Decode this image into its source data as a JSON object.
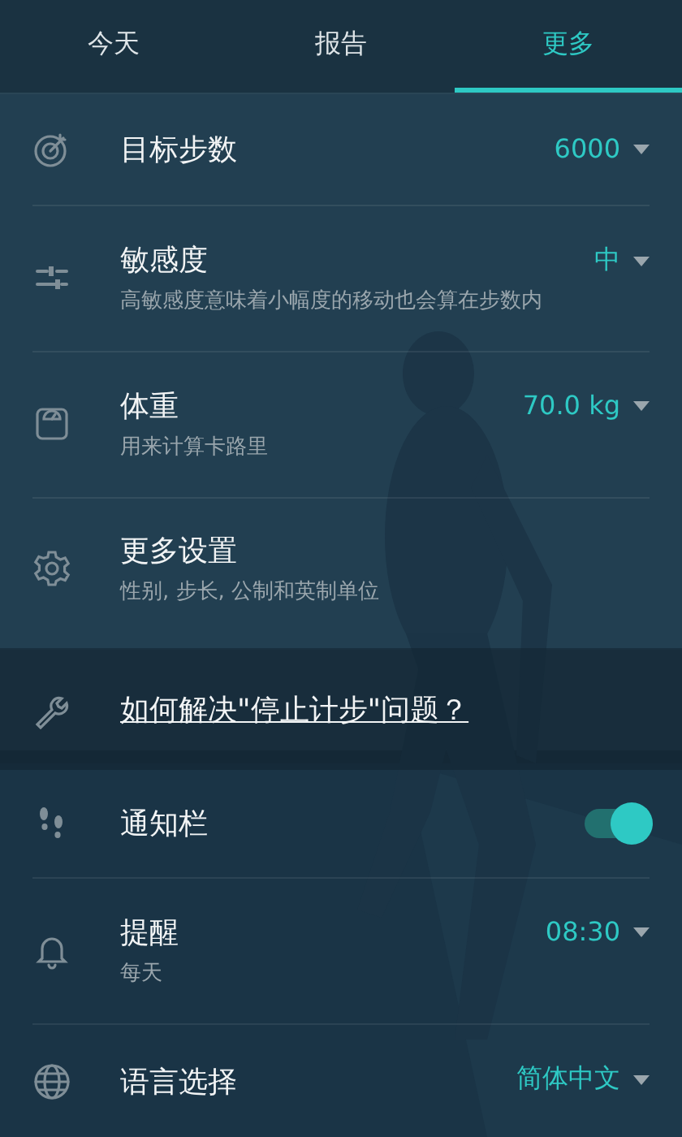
{
  "tabs": [
    {
      "label": "今天",
      "selected": false
    },
    {
      "label": "报告",
      "selected": false
    },
    {
      "label": "更多",
      "selected": true
    }
  ],
  "settings": [
    {
      "kind": "dropdown",
      "title": "目标步数",
      "value": "6000"
    },
    {
      "kind": "dropdown",
      "title": "敏感度",
      "subtitle": "高敏感度意味着小幅度的移动也会算在步数内",
      "value": "中"
    },
    {
      "kind": "dropdown",
      "title": "体重",
      "subtitle": "用来计算卡路里",
      "value": "70.0 kg"
    },
    {
      "kind": "plain",
      "title": "更多设置",
      "subtitle": "性别, 步长, 公制和英制单位"
    },
    {
      "kind": "link",
      "title": "如何解决\"停止计步\"问题？"
    },
    {
      "kind": "toggle",
      "title": "通知栏",
      "on": true
    },
    {
      "kind": "dropdown",
      "title": "提醒",
      "subtitle": "每天",
      "value": "08:30"
    },
    {
      "kind": "dropdown",
      "title": "语言选择",
      "value": "简体中文"
    }
  ]
}
